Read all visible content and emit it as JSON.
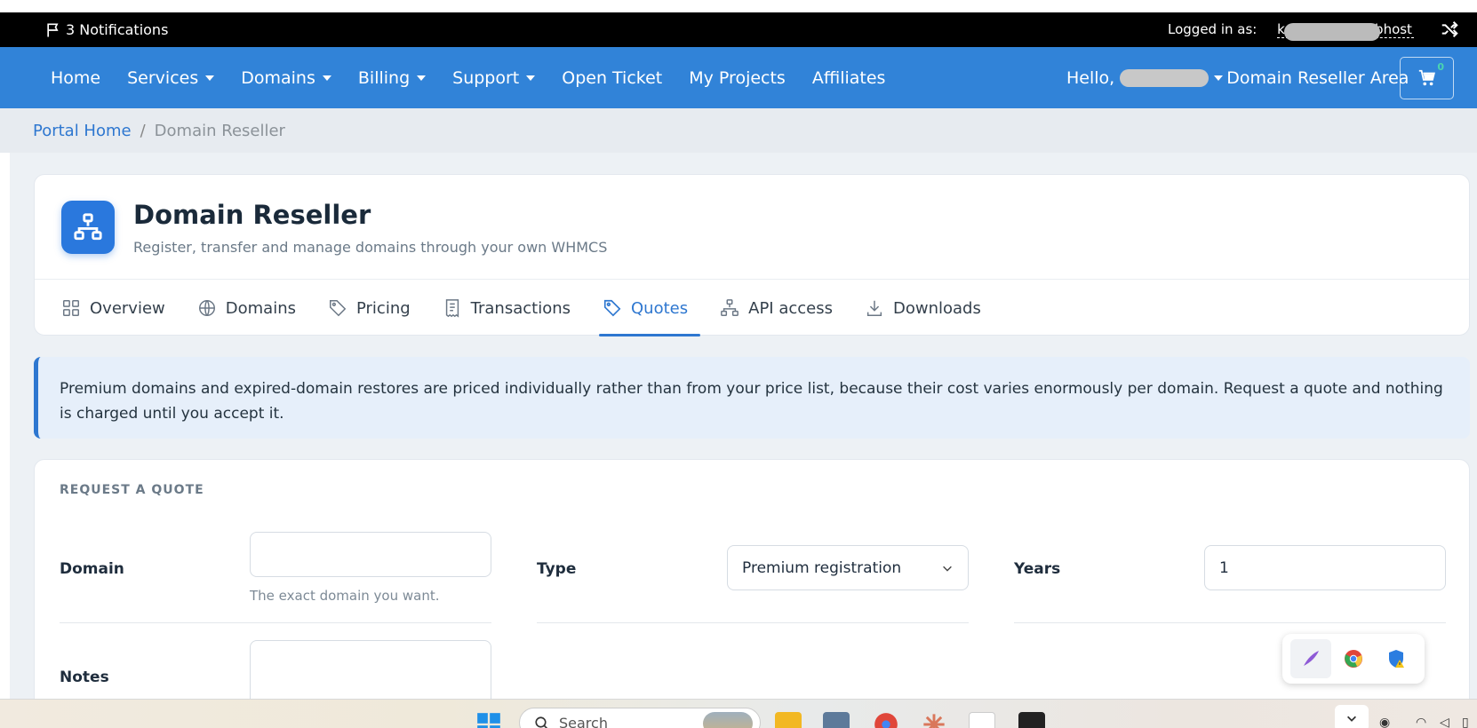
{
  "topbar": {
    "notifications": "3 Notifications",
    "logged_in_label": "Logged in as:",
    "username_visible": "ebhost",
    "username_lead": "k"
  },
  "nav": {
    "items": [
      {
        "label": "Home",
        "dropdown": false
      },
      {
        "label": "Services",
        "dropdown": true
      },
      {
        "label": "Domains",
        "dropdown": true
      },
      {
        "label": "Billing",
        "dropdown": true
      },
      {
        "label": "Support",
        "dropdown": true
      },
      {
        "label": "Open Ticket",
        "dropdown": false
      },
      {
        "label": "My Projects",
        "dropdown": false
      },
      {
        "label": "Affiliates",
        "dropdown": false
      }
    ],
    "hello": "Hello,",
    "reseller_area": "Domain Reseller Area",
    "cart_count": "0"
  },
  "breadcrumb": {
    "home": "Portal Home",
    "separator": "/",
    "current": "Domain Reseller"
  },
  "header": {
    "title": "Domain Reseller",
    "subtitle": "Register, transfer and manage domains through your own WHMCS",
    "icon": "sitemap-icon",
    "accent_color": "#2a78dd"
  },
  "tabs": [
    {
      "label": "Overview",
      "icon": "grid-icon",
      "active": false
    },
    {
      "label": "Domains",
      "icon": "globe-icon",
      "active": false
    },
    {
      "label": "Pricing",
      "icon": "tag-icon",
      "active": false
    },
    {
      "label": "Transactions",
      "icon": "receipt-icon",
      "active": false
    },
    {
      "label": "Quotes",
      "icon": "tag-icon",
      "active": true
    },
    {
      "label": "API access",
      "icon": "network-icon",
      "active": false
    },
    {
      "label": "Downloads",
      "icon": "download-icon",
      "active": false
    }
  ],
  "info": {
    "text": "Premium domains and expired-domain restores are priced individually rather than from your price list, because their cost varies enormously per domain. Request a quote and nothing is charged until you accept it."
  },
  "form": {
    "section_title": "REQUEST A QUOTE",
    "domain_label": "Domain",
    "domain_value": "",
    "domain_hint": "The exact domain you want.",
    "type_label": "Type",
    "type_value": "Premium registration",
    "years_label": "Years",
    "years_value": "1",
    "notes_label": "Notes",
    "notes_value": ""
  },
  "taskbar": {
    "search_placeholder": "Search"
  },
  "colors": {
    "topbar": "#000000",
    "navbar": "#3183d8",
    "link": "#2e77d0",
    "info_bg": "#e6effa"
  }
}
